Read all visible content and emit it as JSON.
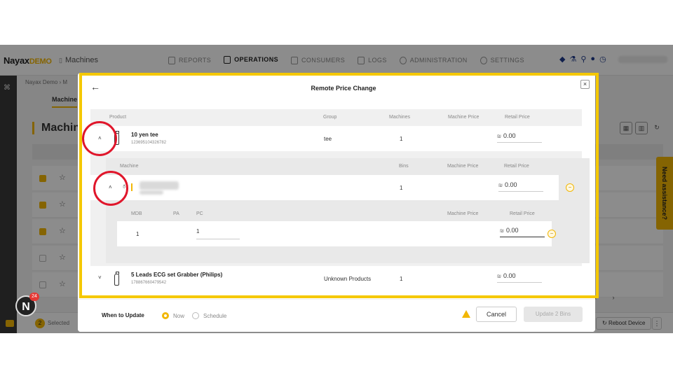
{
  "header": {
    "logo_main": "Nayax",
    "logo_sub": "DEMO",
    "app_name": "Machines",
    "nav": [
      "REPORTS",
      "OPERATIONS",
      "CONSUMERS",
      "LOGS",
      "ADMINISTRATION",
      "SETTINGS"
    ],
    "active_nav": "OPERATIONS"
  },
  "background": {
    "breadcrumb": "Nayax Demo  ›  M",
    "subtab": "Machine",
    "heading": "Machin",
    "selected_count": "2",
    "selected_label": "Selected",
    "reboot_label": "Reboot Device",
    "pager": "‹ ›",
    "need_assistance": "Need assistance?",
    "notifications": "24"
  },
  "modal": {
    "title": "Remote Price Change",
    "columns": {
      "product": "Product",
      "group": "Group",
      "machines": "Machines",
      "machine_price": "Machine Price",
      "retail_price": "Retail Price"
    },
    "products": [
      {
        "name": "10 yen tee",
        "code": "123695104326782",
        "group": "tee",
        "machines": "1",
        "currency": "₪",
        "retail_price": "0.00",
        "expanded": true
      },
      {
        "name": "5 Leads ECG set Grabber (Philips)",
        "code": "178867660479542",
        "group": "Unknown Products",
        "machines": "1",
        "currency": "₪",
        "retail_price": "0.00",
        "expanded": false
      }
    ],
    "machine_section": {
      "columns": {
        "machine": "Machine",
        "bins": "Bins",
        "machine_price": "Machine Price",
        "retail_price": "Retail Price"
      },
      "row": {
        "bins": "1",
        "currency": "₪",
        "retail_price": "0.00"
      }
    },
    "bin_section": {
      "columns": {
        "mdb": "MDB",
        "pa": "PA",
        "pc": "PC",
        "machine_price": "Machine Price",
        "retail_price": "Retail Price"
      },
      "row": {
        "mdb": "1",
        "pc": "1",
        "currency": "₪",
        "retail_price": "0.00"
      }
    },
    "footer": {
      "when_to_update": "When to Update",
      "option_now": "Now",
      "option_schedule": "Schedule",
      "selected_option": "Now",
      "cancel": "Cancel",
      "update": "Update 2 Bins"
    }
  },
  "colors": {
    "accent": "#f2b705",
    "highlight_frame": "#f5c800",
    "annotation_ring": "#e0162b"
  }
}
